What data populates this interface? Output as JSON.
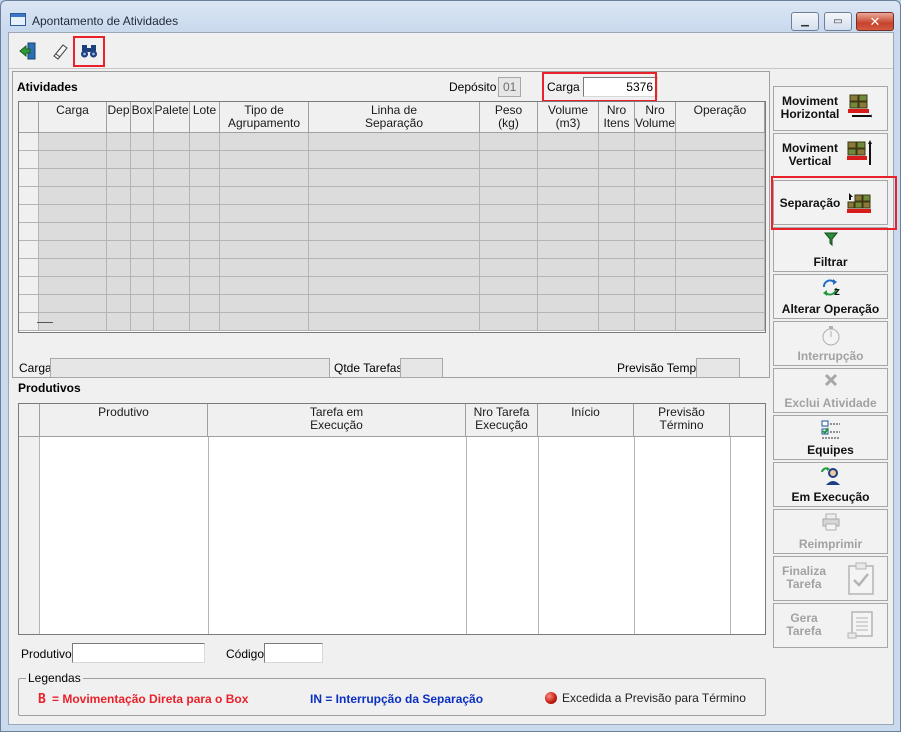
{
  "window": {
    "title": "Apontamento de Atividades"
  },
  "toolbar": {
    "icons": [
      "exit-door-icon",
      "eraser-icon",
      "binoculars-icon"
    ]
  },
  "atividades": {
    "title": "Atividades",
    "deposito_label": "Depósito",
    "deposito_value": "01",
    "carga_label": "Carga",
    "carga_value": "5376",
    "columns": [
      "Carga",
      "Dep",
      "Box",
      "Palete",
      "Lote",
      "Tipo de\nAgrupamento",
      "Linha de\nSeparação",
      "Peso\n(kg)",
      "Volume\n(m3)",
      "Nro\nItens",
      "Nro\nVolume",
      "Operação"
    ]
  },
  "summary": {
    "carga_label": "Carga",
    "carga_value": "",
    "qtde_label": "Qtde Tarefas",
    "qtde_value": "",
    "previsao_label": "Previsão Tempo",
    "previsao_value": ""
  },
  "produtivos": {
    "title": "Produtivos",
    "columns": [
      "Produtivo",
      "Tarefa em\nExecução",
      "Nro Tarefa\nExecução",
      "Início",
      "Previsão\nTérmino"
    ]
  },
  "filters": {
    "produtivo_label": "Produtivo",
    "produtivo_value": "",
    "codigo_label": "Código",
    "codigo_value": ""
  },
  "side_buttons": [
    {
      "label": "Moviment\nHorizontal",
      "icon": "pallet-horizontal-icon",
      "enabled": true
    },
    {
      "label": "Moviment\nVertical",
      "icon": "pallet-vertical-icon",
      "enabled": true
    },
    {
      "label": "Separação",
      "icon": "pallet-separation-icon",
      "enabled": true
    },
    {
      "label": "Filtrar",
      "icon": "filter-icon",
      "enabled": true
    },
    {
      "label": "Alterar Operação",
      "icon": "swap-operation-icon",
      "enabled": true
    },
    {
      "label": "Interrupção",
      "icon": "stopwatch-icon",
      "enabled": false
    },
    {
      "label": "Exclui Atividade",
      "icon": "delete-x-icon",
      "enabled": false
    },
    {
      "label": "Equipes",
      "icon": "checklist-icon",
      "enabled": true
    },
    {
      "label": "Em Execução",
      "icon": "user-running-icon",
      "enabled": true
    },
    {
      "label": "Reimprimir",
      "icon": "printer-icon",
      "enabled": false
    },
    {
      "label": "Finaliza\nTarefa",
      "icon": "clipboard-check-icon",
      "enabled": false
    },
    {
      "label": "Gera\nTarefa",
      "icon": "scroll-icon",
      "enabled": false
    }
  ],
  "legend": {
    "title": "Legendas",
    "item1_marker": "B",
    "item1_text": "= Movimentação Direta para o Box",
    "item2": "IN = Interrupção da Separação",
    "item3": "Excedida a Previsão para Término",
    "colors": {
      "red": "#e8212a",
      "blue": "#0b2fbf"
    }
  }
}
